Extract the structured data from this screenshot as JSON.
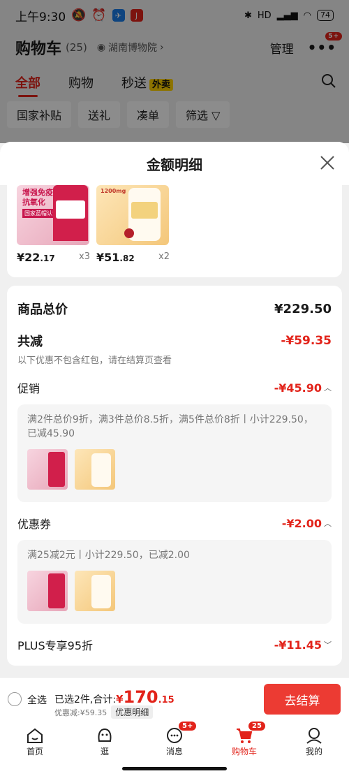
{
  "status": {
    "time": "上午9:30",
    "battery": "74",
    "net": "HD"
  },
  "header": {
    "title": "购物车",
    "count": "(25)",
    "location": "湖南博物院",
    "manage": "管理",
    "more_badge": "5+"
  },
  "tabs": [
    {
      "label": "全部"
    },
    {
      "label": "购物"
    },
    {
      "label": "秒送"
    }
  ],
  "tab_tag": "外卖",
  "filters": [
    "国家补贴",
    "送礼",
    "凑单",
    "筛选"
  ],
  "sheet": {
    "title": "金额明细"
  },
  "products": [
    {
      "price_int": "¥22",
      "price_dec": ".17",
      "qty": "x3",
      "img_text": "增强免疫\n抗氧化"
    },
    {
      "price_int": "¥51",
      "price_dec": ".82",
      "qty": "x2",
      "img_text": "1200mg"
    }
  ],
  "details": {
    "total_label": "商品总价",
    "total_value": "¥229.50",
    "reduce_label": "共减",
    "reduce_value": "-¥59.35",
    "note": "以下优惠不包含红包，请在结算页查看",
    "promo_label": "促销",
    "promo_value": "-¥45.90",
    "promo_text": "满2件总价9折，满3件总价8.5折，满5件总价8折丨小计229.50，已减45.90",
    "coupon_label": "优惠券",
    "coupon_value": "-¥2.00",
    "coupon_text": "满25减2元丨小计229.50，已减2.00",
    "plus_label": "PLUS专享95折",
    "plus_value": "-¥11.45"
  },
  "paybar": {
    "select_all": "全选",
    "selected": "已选2件,合计:",
    "yen": "¥",
    "amount_int": "170",
    "amount_dec": ".15",
    "discount": "优惠减:¥59.35",
    "detail_btn": "优惠明细",
    "checkout": "去结算"
  },
  "tabbar": [
    {
      "label": "首页",
      "badge": ""
    },
    {
      "label": "逛",
      "badge": ""
    },
    {
      "label": "消息",
      "badge": "5+"
    },
    {
      "label": "购物车",
      "badge": "25"
    },
    {
      "label": "我的",
      "badge": ""
    }
  ],
  "colors": {
    "accent": "#e2231a",
    "checkout": "#ec3b33"
  }
}
